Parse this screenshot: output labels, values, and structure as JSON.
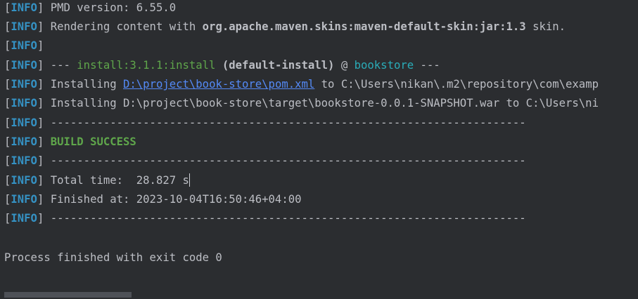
{
  "console": {
    "level": "INFO",
    "lines": {
      "l1": "PMD version: 6.55.0",
      "l2": {
        "pre": "Rendering content with ",
        "bold": "org.apache.maven.skins:maven-default-skin:jar:1.3",
        "post": " skin."
      },
      "l3": "",
      "l4": {
        "dashes_open": "--- ",
        "plugin": "install:3.1.1:install",
        "execution": " (default-install)",
        "at": " @ ",
        "project": "bookstore",
        "dashes_close": " ---"
      },
      "l5": {
        "pre": "Installing ",
        "link": "D:\\project\\book-store\\pom.xml",
        "post": " to C:\\Users\\nikan\\.m2\\repository\\com\\examp"
      },
      "l6": "Installing D:\\project\\book-store\\target\\bookstore-0.0.1-SNAPSHOT.war to C:\\Users\\ni",
      "l7": "------------------------------------------------------------------------",
      "l8": "BUILD SUCCESS",
      "l9": "------------------------------------------------------------------------",
      "l10": "Total time:  28.827 s",
      "l11": "Finished at: 2023-10-04T16:50:46+04:00",
      "l12": "------------------------------------------------------------------------"
    },
    "exit_message": "Process finished with exit code 0"
  }
}
